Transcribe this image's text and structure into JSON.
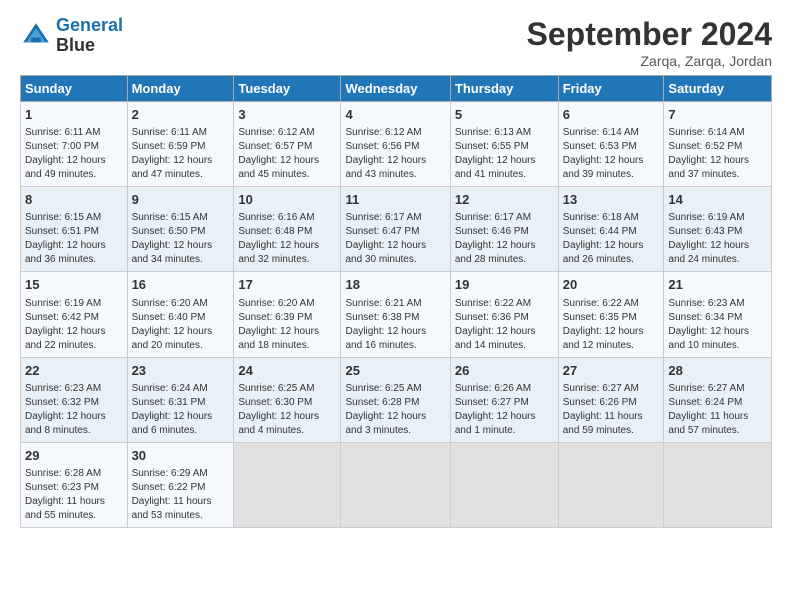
{
  "logo": {
    "line1": "General",
    "line2": "Blue"
  },
  "title": "September 2024",
  "subtitle": "Zarqa, Zarqa, Jordan",
  "days_of_week": [
    "Sunday",
    "Monday",
    "Tuesday",
    "Wednesday",
    "Thursday",
    "Friday",
    "Saturday"
  ],
  "weeks": [
    [
      {
        "day": 1,
        "lines": [
          "Sunrise: 6:11 AM",
          "Sunset: 7:00 PM",
          "Daylight: 12 hours",
          "and 49 minutes."
        ]
      },
      {
        "day": 2,
        "lines": [
          "Sunrise: 6:11 AM",
          "Sunset: 6:59 PM",
          "Daylight: 12 hours",
          "and 47 minutes."
        ]
      },
      {
        "day": 3,
        "lines": [
          "Sunrise: 6:12 AM",
          "Sunset: 6:57 PM",
          "Daylight: 12 hours",
          "and 45 minutes."
        ]
      },
      {
        "day": 4,
        "lines": [
          "Sunrise: 6:12 AM",
          "Sunset: 6:56 PM",
          "Daylight: 12 hours",
          "and 43 minutes."
        ]
      },
      {
        "day": 5,
        "lines": [
          "Sunrise: 6:13 AM",
          "Sunset: 6:55 PM",
          "Daylight: 12 hours",
          "and 41 minutes."
        ]
      },
      {
        "day": 6,
        "lines": [
          "Sunrise: 6:14 AM",
          "Sunset: 6:53 PM",
          "Daylight: 12 hours",
          "and 39 minutes."
        ]
      },
      {
        "day": 7,
        "lines": [
          "Sunrise: 6:14 AM",
          "Sunset: 6:52 PM",
          "Daylight: 12 hours",
          "and 37 minutes."
        ]
      }
    ],
    [
      {
        "day": 8,
        "lines": [
          "Sunrise: 6:15 AM",
          "Sunset: 6:51 PM",
          "Daylight: 12 hours",
          "and 36 minutes."
        ]
      },
      {
        "day": 9,
        "lines": [
          "Sunrise: 6:15 AM",
          "Sunset: 6:50 PM",
          "Daylight: 12 hours",
          "and 34 minutes."
        ]
      },
      {
        "day": 10,
        "lines": [
          "Sunrise: 6:16 AM",
          "Sunset: 6:48 PM",
          "Daylight: 12 hours",
          "and 32 minutes."
        ]
      },
      {
        "day": 11,
        "lines": [
          "Sunrise: 6:17 AM",
          "Sunset: 6:47 PM",
          "Daylight: 12 hours",
          "and 30 minutes."
        ]
      },
      {
        "day": 12,
        "lines": [
          "Sunrise: 6:17 AM",
          "Sunset: 6:46 PM",
          "Daylight: 12 hours",
          "and 28 minutes."
        ]
      },
      {
        "day": 13,
        "lines": [
          "Sunrise: 6:18 AM",
          "Sunset: 6:44 PM",
          "Daylight: 12 hours",
          "and 26 minutes."
        ]
      },
      {
        "day": 14,
        "lines": [
          "Sunrise: 6:19 AM",
          "Sunset: 6:43 PM",
          "Daylight: 12 hours",
          "and 24 minutes."
        ]
      }
    ],
    [
      {
        "day": 15,
        "lines": [
          "Sunrise: 6:19 AM",
          "Sunset: 6:42 PM",
          "Daylight: 12 hours",
          "and 22 minutes."
        ]
      },
      {
        "day": 16,
        "lines": [
          "Sunrise: 6:20 AM",
          "Sunset: 6:40 PM",
          "Daylight: 12 hours",
          "and 20 minutes."
        ]
      },
      {
        "day": 17,
        "lines": [
          "Sunrise: 6:20 AM",
          "Sunset: 6:39 PM",
          "Daylight: 12 hours",
          "and 18 minutes."
        ]
      },
      {
        "day": 18,
        "lines": [
          "Sunrise: 6:21 AM",
          "Sunset: 6:38 PM",
          "Daylight: 12 hours",
          "and 16 minutes."
        ]
      },
      {
        "day": 19,
        "lines": [
          "Sunrise: 6:22 AM",
          "Sunset: 6:36 PM",
          "Daylight: 12 hours",
          "and 14 minutes."
        ]
      },
      {
        "day": 20,
        "lines": [
          "Sunrise: 6:22 AM",
          "Sunset: 6:35 PM",
          "Daylight: 12 hours",
          "and 12 minutes."
        ]
      },
      {
        "day": 21,
        "lines": [
          "Sunrise: 6:23 AM",
          "Sunset: 6:34 PM",
          "Daylight: 12 hours",
          "and 10 minutes."
        ]
      }
    ],
    [
      {
        "day": 22,
        "lines": [
          "Sunrise: 6:23 AM",
          "Sunset: 6:32 PM",
          "Daylight: 12 hours",
          "and 8 minutes."
        ]
      },
      {
        "day": 23,
        "lines": [
          "Sunrise: 6:24 AM",
          "Sunset: 6:31 PM",
          "Daylight: 12 hours",
          "and 6 minutes."
        ]
      },
      {
        "day": 24,
        "lines": [
          "Sunrise: 6:25 AM",
          "Sunset: 6:30 PM",
          "Daylight: 12 hours",
          "and 4 minutes."
        ]
      },
      {
        "day": 25,
        "lines": [
          "Sunrise: 6:25 AM",
          "Sunset: 6:28 PM",
          "Daylight: 12 hours",
          "and 3 minutes."
        ]
      },
      {
        "day": 26,
        "lines": [
          "Sunrise: 6:26 AM",
          "Sunset: 6:27 PM",
          "Daylight: 12 hours",
          "and 1 minute."
        ]
      },
      {
        "day": 27,
        "lines": [
          "Sunrise: 6:27 AM",
          "Sunset: 6:26 PM",
          "Daylight: 11 hours",
          "and 59 minutes."
        ]
      },
      {
        "day": 28,
        "lines": [
          "Sunrise: 6:27 AM",
          "Sunset: 6:24 PM",
          "Daylight: 11 hours",
          "and 57 minutes."
        ]
      }
    ],
    [
      {
        "day": 29,
        "lines": [
          "Sunrise: 6:28 AM",
          "Sunset: 6:23 PM",
          "Daylight: 11 hours",
          "and 55 minutes."
        ]
      },
      {
        "day": 30,
        "lines": [
          "Sunrise: 6:29 AM",
          "Sunset: 6:22 PM",
          "Daylight: 11 hours",
          "and 53 minutes."
        ]
      },
      null,
      null,
      null,
      null,
      null
    ]
  ]
}
